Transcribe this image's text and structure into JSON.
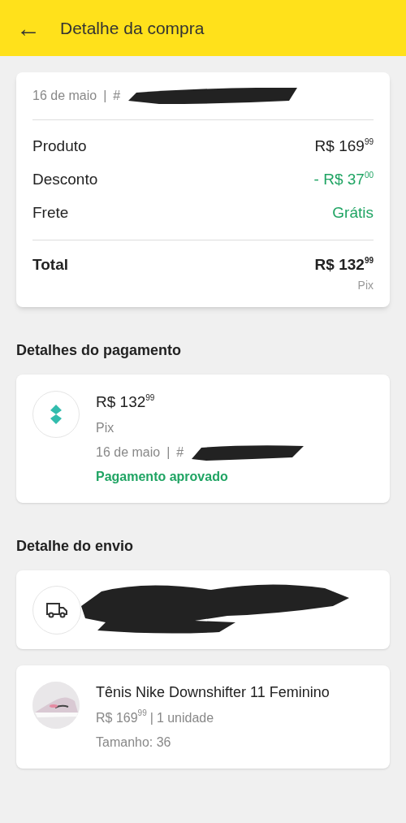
{
  "header": {
    "back": "←",
    "title": "Detalhe da compra"
  },
  "summary": {
    "date": "16 de maio",
    "separator": "|",
    "order_prefix": "#",
    "rows": [
      {
        "label": "Produto",
        "value": "R$ 169$^{99}$",
        "kind": "normal"
      },
      {
        "label": "Desconto",
        "value": "- R$ 37$^{00}$",
        "kind": "positive"
      },
      {
        "label": "Frete",
        "value": "Grátis",
        "kind": "positive"
      }
    ],
    "total": {
      "label": "Total",
      "value": "R$ 132$^{99}$",
      "method": "Pix"
    }
  },
  "payment": {
    "heading": "Detalhes do pagamento",
    "amount": "R$ 132$^{99}$",
    "method": "Pix",
    "date": "16 de maio",
    "separator": "|",
    "order_prefix": "#",
    "status": "Pagamento aprovado"
  },
  "shipping": {
    "heading": "Detalhe do envio"
  },
  "product": {
    "title": "Tênis Nike Downshifter 11 Feminino",
    "price": "R$ 169$^{99}$",
    "separator": "|",
    "quantity": "1 unidade",
    "size": "Tamanho: 36"
  }
}
